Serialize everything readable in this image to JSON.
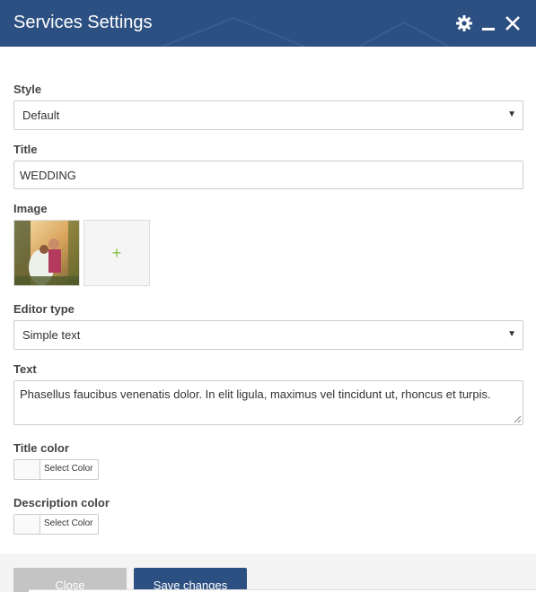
{
  "window": {
    "title": "Services Settings",
    "header_color": "#2d5082",
    "icons": [
      "gear-icon",
      "minimize-icon",
      "close-icon"
    ]
  },
  "style_field": {
    "label": "Style",
    "value": "Default"
  },
  "title_field": {
    "label": "Title",
    "value": "WEDDING"
  },
  "image_field": {
    "label": "Image",
    "add_label": "+"
  },
  "editor_type_field": {
    "label": "Editor type",
    "value": "Simple text"
  },
  "text_field": {
    "label": "Text",
    "value": "Phasellus faucibus venenatis dolor. In elit ligula, maximus vel tincidunt ut, rhoncus et turpis."
  },
  "title_color_field": {
    "label": "Title color",
    "button": "Select Color"
  },
  "description_color_field": {
    "label": "Description color",
    "button": "Select Color"
  },
  "footer": {
    "close_label": "Close",
    "save_label": "Save changes",
    "save_color": "#2d5082"
  }
}
